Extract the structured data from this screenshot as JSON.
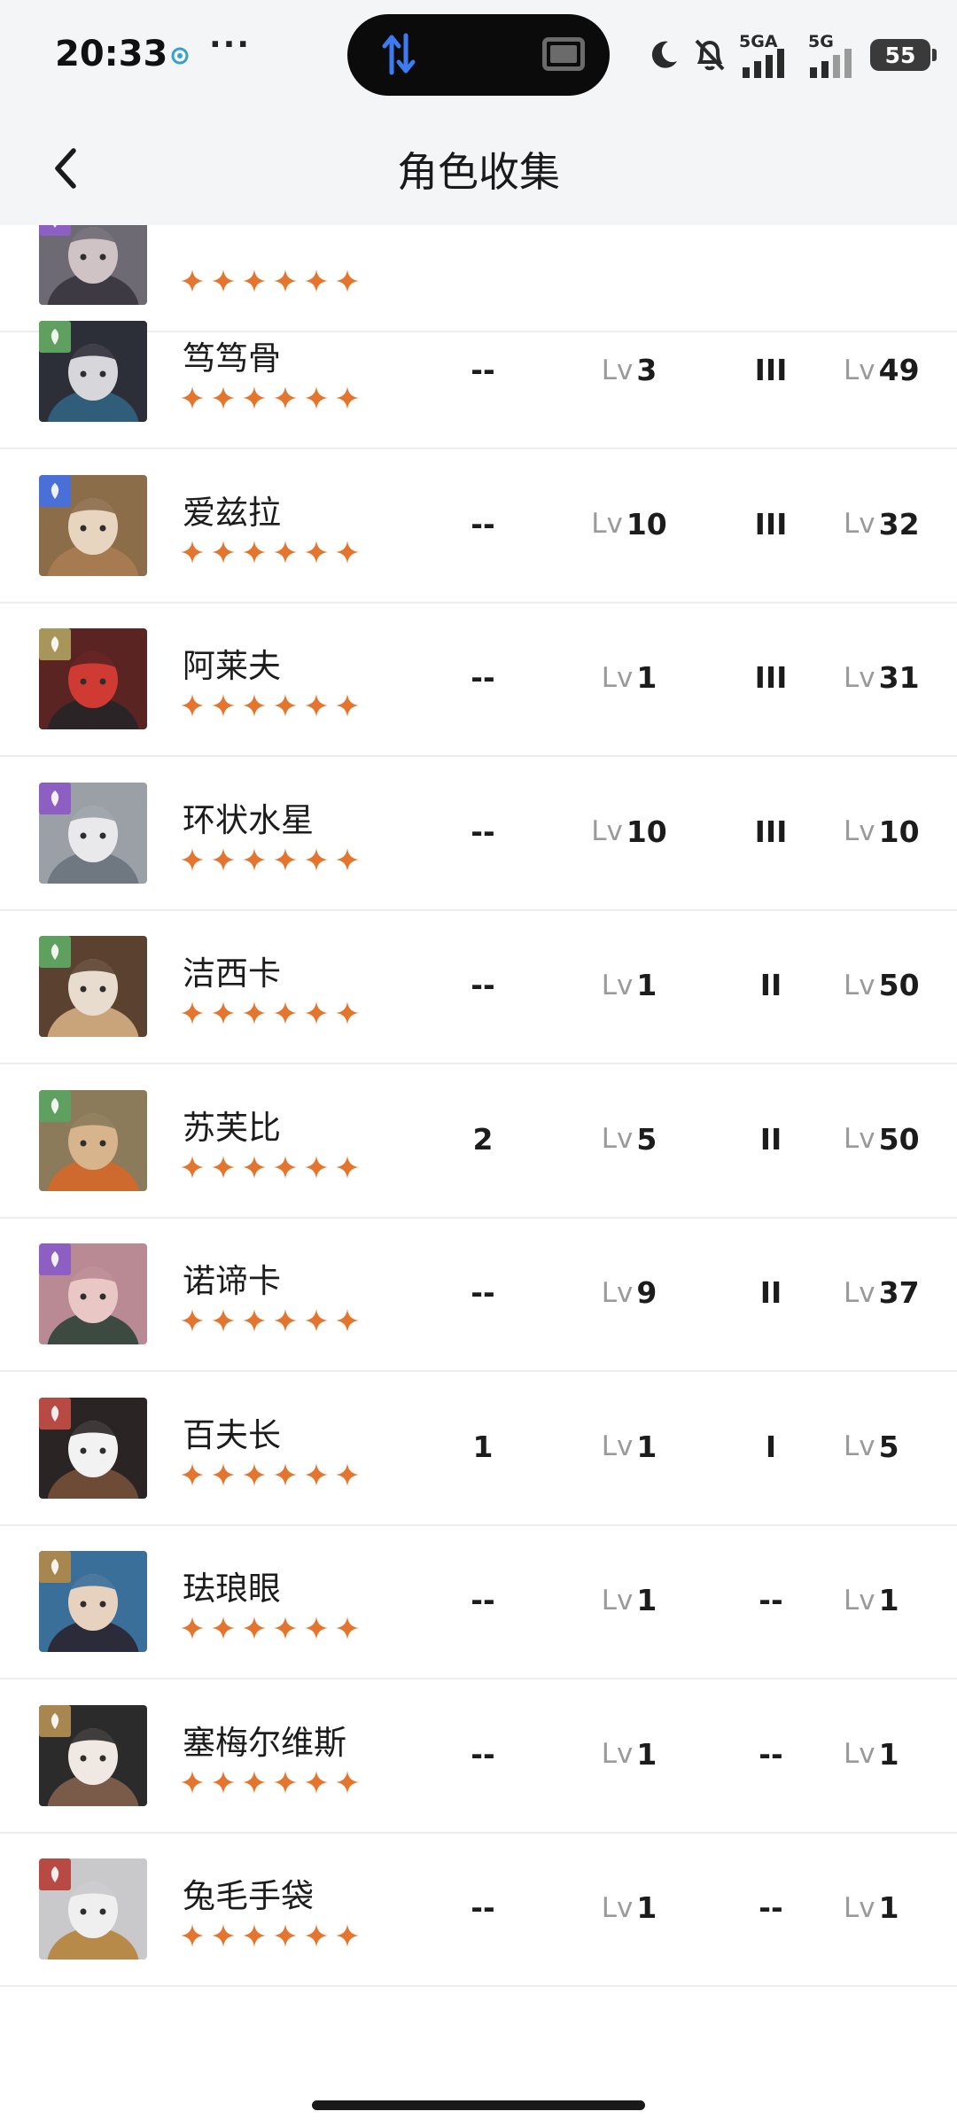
{
  "status_bar": {
    "time": "20:33",
    "dots": "···",
    "battery": "55",
    "network_1": "5GA",
    "network_2": "5G",
    "icons": [
      "vpn-icon",
      "transfer-arrows-icon",
      "screen-icon",
      "moon-icon",
      "mute-bell-icon",
      "signal-icon",
      "signal-icon",
      "battery-icon"
    ]
  },
  "header": {
    "title": "角色收集",
    "back_icon": "chevron-left-icon"
  },
  "colors": {
    "star": "#E3752F",
    "green": "#5FA061",
    "blue": "#4A6FD6",
    "olive": "#A7955A",
    "purple": "#8E5FC2",
    "red": "#B84A44",
    "gold": "#A8864F"
  },
  "rows": [
    {
      "name": "",
      "element": "purple",
      "stars": 6,
      "c1": "",
      "c2": "",
      "c3": "",
      "c4": "",
      "lv_label": ""
    },
    {
      "name": "笃笃骨",
      "element": "green",
      "stars": 6,
      "c1": "--",
      "lv_label": "Lv",
      "c2": "3",
      "c3": "III",
      "c4": "49"
    },
    {
      "name": "爱兹拉",
      "element": "blue",
      "stars": 6,
      "c1": "--",
      "lv_label": "Lv",
      "c2": "10",
      "c3": "III",
      "c4": "32"
    },
    {
      "name": "阿莱夫",
      "element": "olive",
      "stars": 6,
      "c1": "--",
      "lv_label": "Lv",
      "c2": "1",
      "c3": "III",
      "c4": "31"
    },
    {
      "name": "环状水星",
      "element": "purple",
      "stars": 6,
      "c1": "--",
      "lv_label": "Lv",
      "c2": "10",
      "c3": "III",
      "c4": "10"
    },
    {
      "name": "洁西卡",
      "element": "green",
      "stars": 6,
      "c1": "--",
      "lv_label": "Lv",
      "c2": "1",
      "c3": "II",
      "c4": "50"
    },
    {
      "name": "苏芙比",
      "element": "green",
      "stars": 6,
      "c1": "2",
      "lv_label": "Lv",
      "c2": "5",
      "c3": "II",
      "c4": "50"
    },
    {
      "name": "诺谛卡",
      "element": "purple",
      "stars": 6,
      "c1": "--",
      "lv_label": "Lv",
      "c2": "9",
      "c3": "II",
      "c4": "37"
    },
    {
      "name": "百夫长",
      "element": "red",
      "stars": 6,
      "c1": "1",
      "lv_label": "Lv",
      "c2": "1",
      "c3": "I",
      "c4": "5"
    },
    {
      "name": "珐琅眼",
      "element": "gold",
      "stars": 6,
      "c1": "--",
      "lv_label": "Lv",
      "c2": "1",
      "c3": "--",
      "c4": "1"
    },
    {
      "name": "塞梅尔维斯",
      "element": "gold",
      "stars": 6,
      "c1": "--",
      "lv_label": "Lv",
      "c2": "1",
      "c3": "--",
      "c4": "1"
    },
    {
      "name": "兔毛手袋",
      "element": "red",
      "stars": 6,
      "c1": "--",
      "lv_label": "Lv",
      "c2": "1",
      "c3": "--",
      "c4": "1"
    }
  ]
}
